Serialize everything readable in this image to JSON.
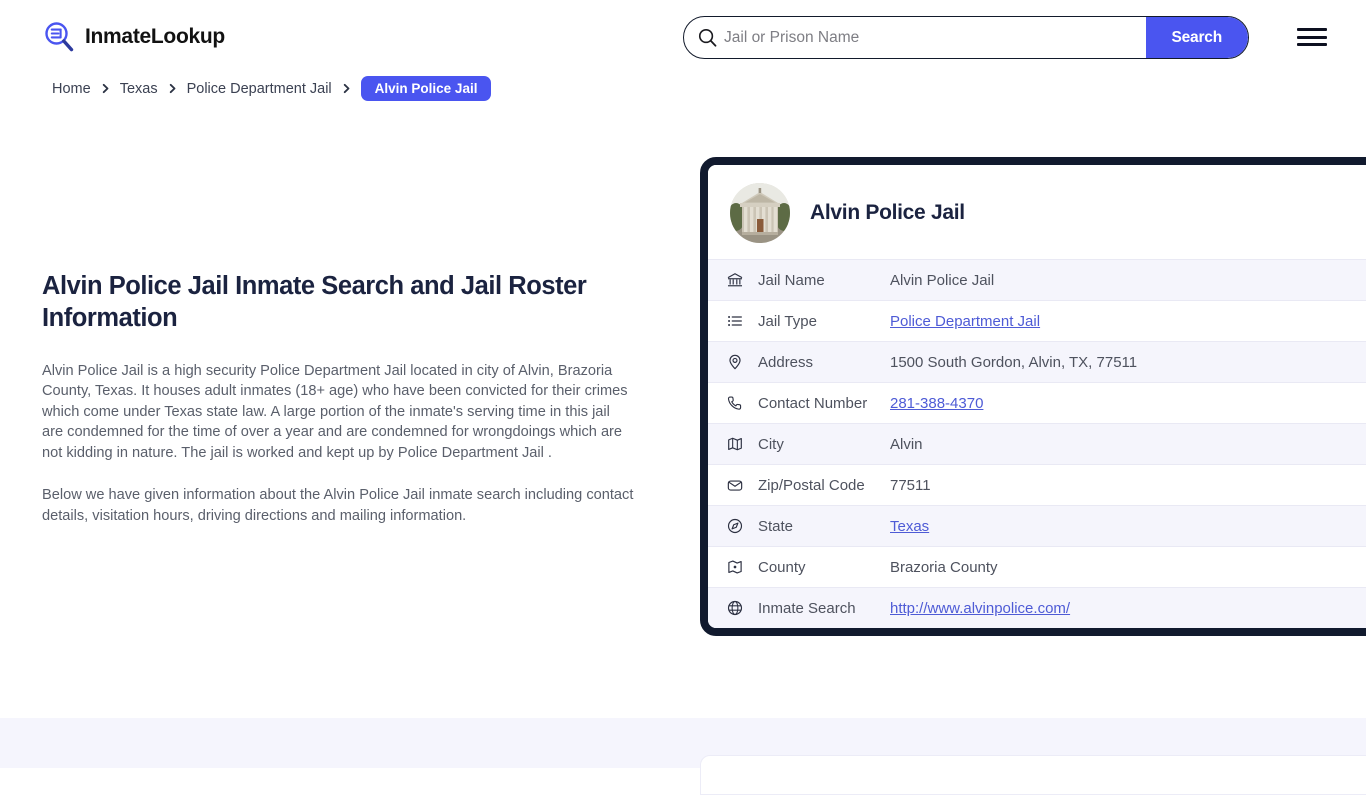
{
  "header": {
    "brand_name": "InmateLookup",
    "brand_icon": "magnifier-list-logo-icon",
    "menu_icon": "hamburger-menu-icon",
    "search": {
      "icon": "search-icon",
      "placeholder": "Jail or Prison Name",
      "value": "",
      "button_label": "Search"
    }
  },
  "breadcrumb": {
    "items": [
      {
        "label": "Home",
        "current": false
      },
      {
        "label": "Texas",
        "current": false
      },
      {
        "label": "Police Department Jail",
        "current": false
      },
      {
        "label": "Alvin Police Jail",
        "current": true
      }
    ],
    "separator_icon": "chevron-right-icon"
  },
  "main": {
    "page_title": "Alvin Police Jail Inmate Search and Jail Roster Information",
    "paragraph_1": "Alvin Police Jail is a high security Police Department Jail located in city of Alvin, Brazoria County, Texas. It houses adult inmates (18+ age) who have been convicted for their crimes which come under Texas state law. A large portion of the inmate's serving time in this jail are condemned for the time of over a year and are condemned for wrongdoings which are not kidding in nature. The jail is worked and kept up by Police Department Jail .",
    "paragraph_2": "Below we have given information about the Alvin Police Jail inmate search including contact details, visitation hours, driving directions and mailing information."
  },
  "info_card": {
    "photo_icon": "courthouse-building-photo",
    "title": "Alvin Police Jail",
    "rows": [
      {
        "icon": "bank-icon",
        "label": "Jail Name",
        "value": "Alvin Police Jail",
        "link": false
      },
      {
        "icon": "list-icon",
        "label": "Jail Type",
        "value": "Police Department Jail",
        "link": true
      },
      {
        "icon": "map-pin-icon",
        "label": "Address",
        "value": "1500 South Gordon, Alvin, TX, 77511",
        "link": false
      },
      {
        "icon": "phone-icon",
        "label": "Contact Number",
        "value": "281-388-4370",
        "link": true
      },
      {
        "icon": "map-icon",
        "label": "City",
        "value": "Alvin",
        "link": false
      },
      {
        "icon": "envelope-icon",
        "label": "Zip/Postal Code",
        "value": "77511",
        "link": false
      },
      {
        "icon": "compass-icon",
        "label": "State",
        "value": "Texas",
        "link": true
      },
      {
        "icon": "county-map-icon",
        "label": "County",
        "value": "Brazoria County",
        "link": false
      },
      {
        "icon": "globe-icon",
        "label": "Inmate Search",
        "value": "http://www.alvinpolice.com/",
        "link": true
      }
    ]
  },
  "colors": {
    "accent_blue": "#4a55f0",
    "link_blue": "#4e5bd6",
    "card_border_navy": "#111a2e",
    "row_stripe": "#f5f5fc",
    "band_lavender": "#f5f5fd",
    "title_navy": "#1b2340",
    "body_gray": "#5a5f6b"
  }
}
